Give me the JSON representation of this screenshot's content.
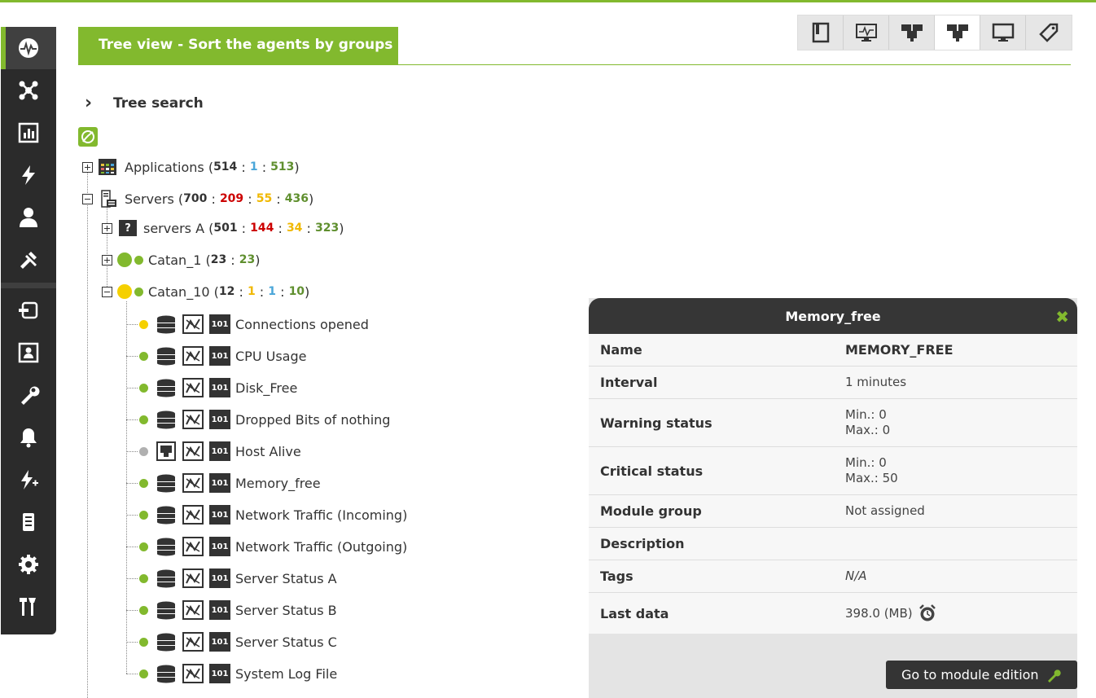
{
  "header": {
    "title": "Tree view - Sort the agents by groups"
  },
  "search": {
    "label": "Tree search"
  },
  "tree": {
    "applications": {
      "name": "Applications",
      "total": "514",
      "blue": "1",
      "green": "513"
    },
    "servers": {
      "name": "Servers",
      "total": "700",
      "red": "209",
      "yellow": "55",
      "green": "436"
    },
    "servers_a": {
      "name": "servers A",
      "total": "501",
      "red": "144",
      "yellow": "34",
      "green": "323"
    },
    "catan1": {
      "name": "Catan_1",
      "total": "23",
      "green": "23"
    },
    "catan10": {
      "name": "Catan_10",
      "total": "12",
      "yellow": "1",
      "blue": "1",
      "green": "10"
    },
    "modules": [
      {
        "name": "Connections opened",
        "status": "#f5d000",
        "icon": "database-icon"
      },
      {
        "name": "CPU Usage",
        "status": "#82b92e",
        "icon": "database-icon"
      },
      {
        "name": "Disk_Free",
        "status": "#82b92e",
        "icon": "database-icon"
      },
      {
        "name": "Dropped Bits of nothing",
        "status": "#82b92e",
        "icon": "database-icon"
      },
      {
        "name": "Host Alive",
        "status": "#b0b0b0",
        "icon": "network-icon"
      },
      {
        "name": "Memory_free",
        "status": "#82b92e",
        "icon": "database-icon"
      },
      {
        "name": "Network Traffic (Incoming)",
        "status": "#82b92e",
        "icon": "database-icon"
      },
      {
        "name": "Network Traffic (Outgoing)",
        "status": "#82b92e",
        "icon": "database-icon"
      },
      {
        "name": "Server Status A",
        "status": "#82b92e",
        "icon": "database-icon"
      },
      {
        "name": "Server Status B",
        "status": "#82b92e",
        "icon": "database-icon"
      },
      {
        "name": "Server Status C",
        "status": "#82b92e",
        "icon": "database-icon"
      },
      {
        "name": "System Log File",
        "status": "#82b92e",
        "icon": "database-icon"
      }
    ],
    "type_badge": "101"
  },
  "detail": {
    "title": "Memory_free",
    "rows": [
      {
        "label": "Name",
        "value": "MEMORY_FREE"
      },
      {
        "label": "Interval",
        "value": "1 minutes"
      },
      {
        "label": "Warning status",
        "min": "Min.: 0",
        "max": "Max.: 0"
      },
      {
        "label": "Critical status",
        "min": "Min.: 0",
        "max": "Max.: 50"
      },
      {
        "label": "Module group",
        "value": "Not assigned"
      },
      {
        "label": "Description",
        "value": ""
      },
      {
        "label": "Tags",
        "value": "N/A"
      },
      {
        "label": "Last data",
        "value": "398.0 (MB)"
      }
    ],
    "edit_button": "Go to module edition"
  },
  "colors": {
    "accent": "#82b92e",
    "red": "#cc0000",
    "yellow": "#f0b800",
    "blue": "#4aa6d9",
    "dark": "#2b2b2b"
  }
}
